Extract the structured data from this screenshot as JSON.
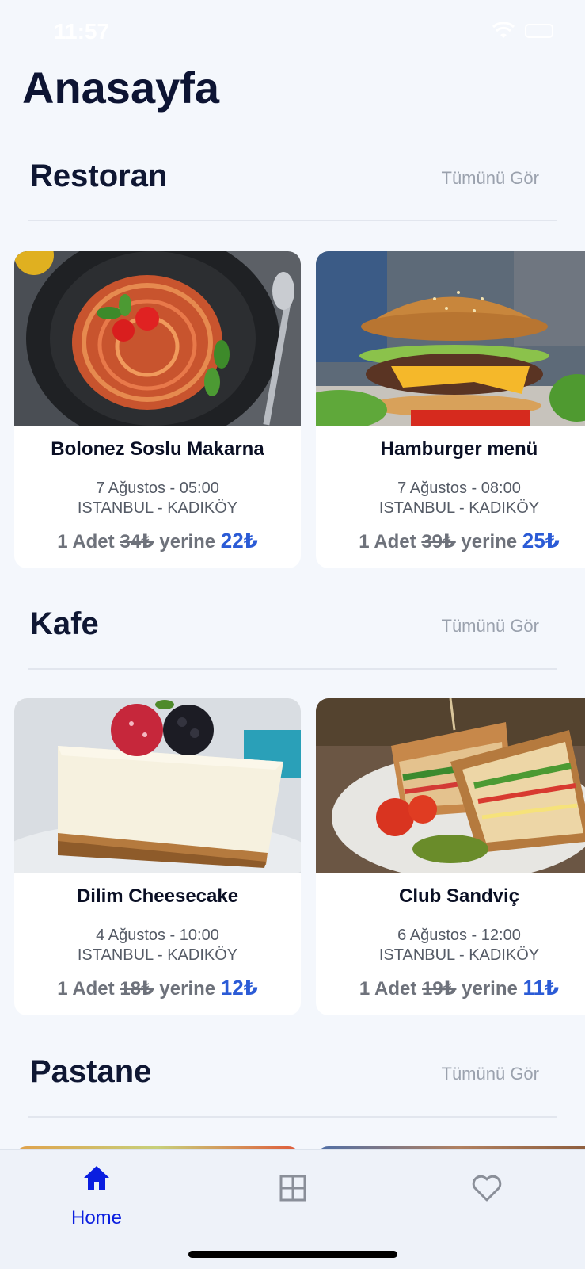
{
  "status": {
    "time": "11:57"
  },
  "page": {
    "title": "Anasayfa"
  },
  "sections": [
    {
      "title": "Restoran",
      "see_all": "Tümünü Gör",
      "cards": [
        {
          "title": "Bolonez Soslu Makarna",
          "date": "7 Ağustos - 05:00",
          "location": "ISTANBUL - KADIKÖY",
          "qty": "1 Adet",
          "old_price": "34₺",
          "word": "yerine",
          "new_price": "22₺",
          "image": "spaghetti-photo"
        },
        {
          "title": "Hamburger menü",
          "date": "7 Ağustos - 08:00",
          "location": "ISTANBUL - KADIKÖY",
          "qty": "1 Adet",
          "old_price": "39₺",
          "word": "yerine",
          "new_price": "25₺",
          "image": "hamburger-photo"
        }
      ]
    },
    {
      "title": "Kafe",
      "see_all": "Tümünü Gör",
      "cards": [
        {
          "title": "Dilim Cheesecake",
          "date": "4 Ağustos - 10:00",
          "location": "ISTANBUL - KADIKÖY",
          "qty": "1 Adet",
          "old_price": "18₺",
          "word": "yerine",
          "new_price": "12₺",
          "image": "cheesecake-photo"
        },
        {
          "title": "Club Sandviç",
          "date": "6 Ağustos - 12:00",
          "location": "ISTANBUL - KADIKÖY",
          "qty": "1 Adet",
          "old_price": "19₺",
          "word": "yerine",
          "new_price": "11₺",
          "image": "sandwich-photo"
        }
      ]
    },
    {
      "title": "Pastane",
      "see_all": "Tümünü Gör"
    }
  ],
  "tabs": [
    {
      "label": "Home",
      "icon": "home-icon",
      "active": true
    },
    {
      "label": "",
      "icon": "grid-icon",
      "active": false
    },
    {
      "label": "",
      "icon": "heart-icon",
      "active": false
    }
  ],
  "colors": {
    "accent": "#0a1ee0",
    "price": "#2b5bd6",
    "background": "#f4f7fc"
  }
}
